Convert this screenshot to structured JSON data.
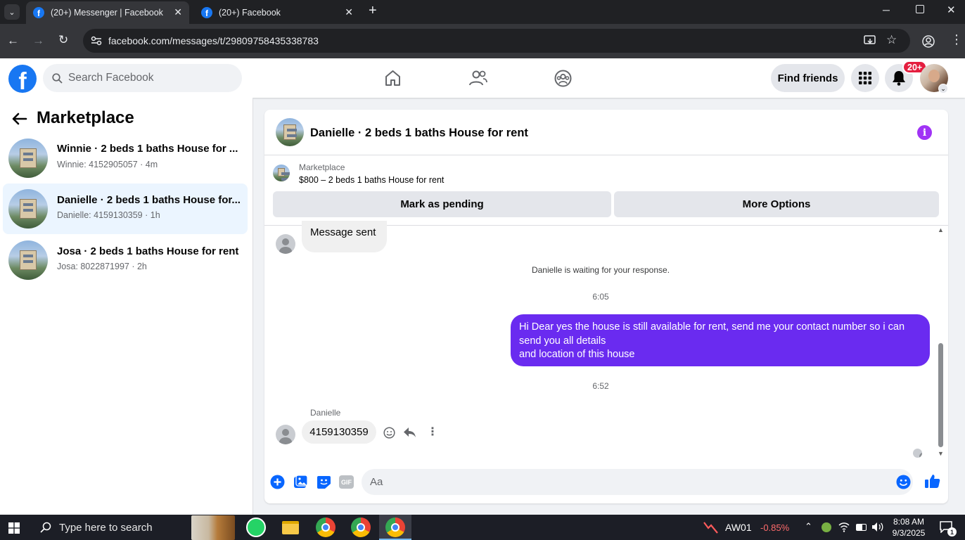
{
  "browser": {
    "tabs": [
      {
        "title": "(20+) Messenger | Facebook"
      },
      {
        "title": "(20+) Facebook"
      }
    ],
    "url": "facebook.com/messages/t/29809758435338783"
  },
  "fb_header": {
    "logo": "f",
    "search_placeholder": "Search Facebook",
    "find_friends": "Find friends",
    "notifications_badge": "20+"
  },
  "sidebar": {
    "title": "Marketplace",
    "conversations": [
      {
        "name": "Winnie · 2 beds 1 baths House for ...",
        "sub": "Winnie: 4152905057 · 4m",
        "selected": false
      },
      {
        "name": "Danielle · 2 beds 1 baths House for...",
        "sub": "Danielle: 4159130359 · 1h",
        "selected": true
      },
      {
        "name": "Josa · 2 beds 1 baths House for rent",
        "sub": "Josa: 8022871997 · 2h",
        "selected": false
      }
    ]
  },
  "chat": {
    "title": "Danielle · 2 beds 1 baths House for rent",
    "listing_label": "Marketplace",
    "listing_title": "$800 – 2 beds 1 baths House for rent",
    "mark_pending": "Mark as pending",
    "more_options": "More Options",
    "messages": {
      "msg1": "Message sent",
      "waiting": "Danielle is waiting for your response.",
      "time1": "6:05",
      "outgoing_line1": "Hi Dear yes the house is still available for rent, send me your contact number so i can send you all details",
      "outgoing_line2": "and location of this house",
      "time2": "6:52",
      "sender": "Danielle",
      "incoming_number": "4159130359"
    },
    "composer_placeholder": "Aa",
    "gif_label": "GIF"
  },
  "taskbar": {
    "search_placeholder": "Type here to search",
    "stock_ticker": "AW01",
    "stock_change": "-0.85%",
    "time": "8:08 AM",
    "date": "9/3/2025",
    "notif_count": "1"
  },
  "colors": {
    "fb_blue": "#1877f2",
    "outgoing_bubble": "#6a2bf0",
    "info_purple": "#a033f5",
    "stock_red": "#ff6b6b"
  }
}
